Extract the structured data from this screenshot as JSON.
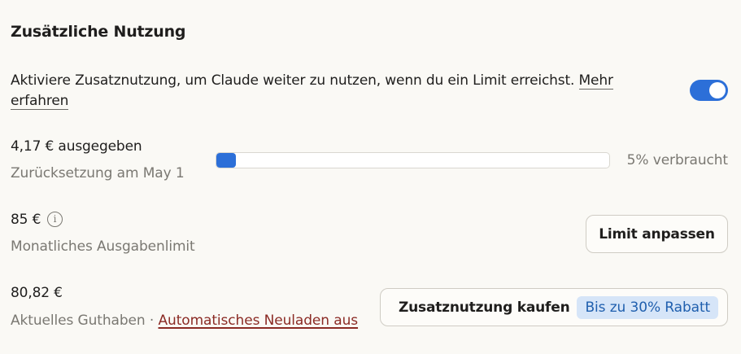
{
  "section": {
    "title": "Zusätzliche Nutzung"
  },
  "activation": {
    "description": "Aktiviere Zusatznutzung, um Claude weiter zu nutzen, wenn du ein Limit erreichst.",
    "learn_more_link": "Mehr erfahren",
    "toggle_enabled": true
  },
  "spent": {
    "amount": "4,17 € ausgegeben",
    "reset_text": "Zurücksetzung am May 1",
    "progress_percent": 5,
    "progress_label": "5% verbraucht"
  },
  "limit": {
    "amount": "85 €",
    "label": "Monatliches Ausgabenlimit",
    "adjust_button": "Limit anpassen"
  },
  "balance": {
    "amount": "80,82 €",
    "label": "Aktuelles Guthaben",
    "separator": "·",
    "auto_reload_link": "Automatisches Neuladen aus",
    "buy_button": "Zusatznutzung kaufen",
    "discount_badge": "Bis zu 30% Rabatt"
  },
  "colors": {
    "accent": "#2c6fd8",
    "link_red": "#8b2b25",
    "badge_bg": "#d6e5f8",
    "background": "#faf9f5"
  }
}
